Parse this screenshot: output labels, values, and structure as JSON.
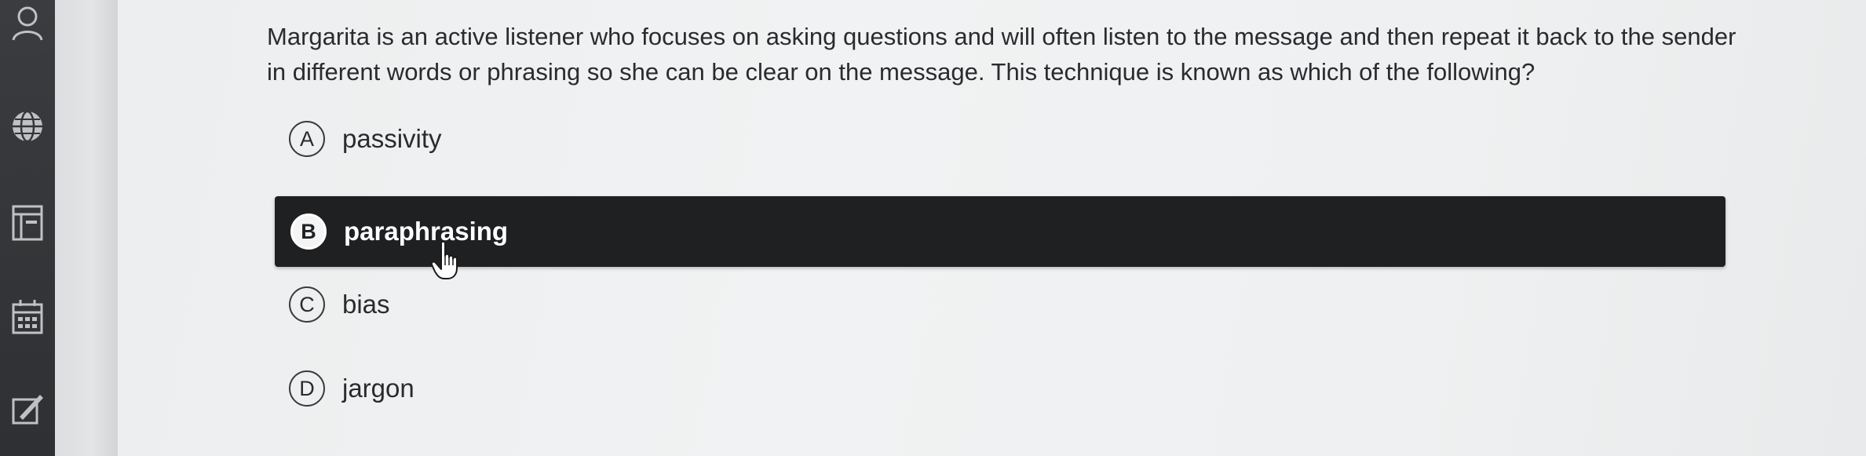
{
  "sidebar": {
    "icons": [
      "user-icon",
      "globe-icon",
      "book-icon",
      "calendar-icon",
      "edit-icon"
    ]
  },
  "question": {
    "text": "Margarita is an active listener who focuses on asking questions and will often listen to the message and then repeat it back to the sender in different words or phrasing so she can be clear on the message. This technique is known as which of the following?"
  },
  "options": [
    {
      "letter": "A",
      "text": "passivity",
      "selected": false
    },
    {
      "letter": "B",
      "text": "paraphrasing",
      "selected": true
    },
    {
      "letter": "C",
      "text": "bias",
      "selected": false
    },
    {
      "letter": "D",
      "text": "jargon",
      "selected": false
    }
  ],
  "colors": {
    "selected_background": "#1f2022",
    "sidebar_background": "#333538",
    "panel_background": "#f0f1f2"
  }
}
